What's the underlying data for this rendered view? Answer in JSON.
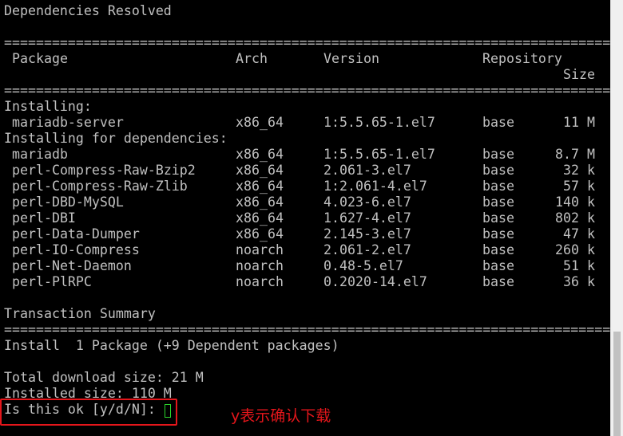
{
  "terminal": {
    "heading": "Dependencies Resolved",
    "separator": "================================================================================",
    "columns": {
      "package": "Package",
      "arch": "Arch",
      "version": "Version",
      "repository": "Repository",
      "size": "Size"
    },
    "installing_label": "Installing:",
    "installing": [
      {
        "package": "mariadb-server",
        "arch": "x86_64",
        "version": "1:5.5.65-1.el7",
        "repo": "base",
        "size": "11 M"
      }
    ],
    "deps_label": "Installing for dependencies:",
    "dependencies": [
      {
        "package": "mariadb",
        "arch": "x86_64",
        "version": "1:5.5.65-1.el7",
        "repo": "base",
        "size": "8.7 M"
      },
      {
        "package": "perl-Compress-Raw-Bzip2",
        "arch": "x86_64",
        "version": "2.061-3.el7",
        "repo": "base",
        "size": "32 k"
      },
      {
        "package": "perl-Compress-Raw-Zlib",
        "arch": "x86_64",
        "version": "1:2.061-4.el7",
        "repo": "base",
        "size": "57 k"
      },
      {
        "package": "perl-DBD-MySQL",
        "arch": "x86_64",
        "version": "4.023-6.el7",
        "repo": "base",
        "size": "140 k"
      },
      {
        "package": "perl-DBI",
        "arch": "x86_64",
        "version": "1.627-4.el7",
        "repo": "base",
        "size": "802 k"
      },
      {
        "package": "perl-Data-Dumper",
        "arch": "x86_64",
        "version": "2.145-3.el7",
        "repo": "base",
        "size": "47 k"
      },
      {
        "package": "perl-IO-Compress",
        "arch": "noarch",
        "version": "2.061-2.el7",
        "repo": "base",
        "size": "260 k"
      },
      {
        "package": "perl-Net-Daemon",
        "arch": "noarch",
        "version": "0.48-5.el7",
        "repo": "base",
        "size": "51 k"
      },
      {
        "package": "perl-PlRPC",
        "arch": "noarch",
        "version": "0.2020-14.el7",
        "repo": "base",
        "size": "36 k"
      }
    ],
    "summary_label": "Transaction Summary",
    "install_line": "Install  1 Package (+9 Dependent packages)",
    "total_download": "Total download size: 21 M",
    "installed_size": "Installed size: 110 M",
    "prompt": "Is this ok [y/d/N]:"
  },
  "annotation": {
    "text": "y表示确认下载",
    "color": "#e4161b"
  },
  "colors": {
    "background": "#000000",
    "text": "#c0c0c0",
    "cursor": "#2bd52b"
  }
}
